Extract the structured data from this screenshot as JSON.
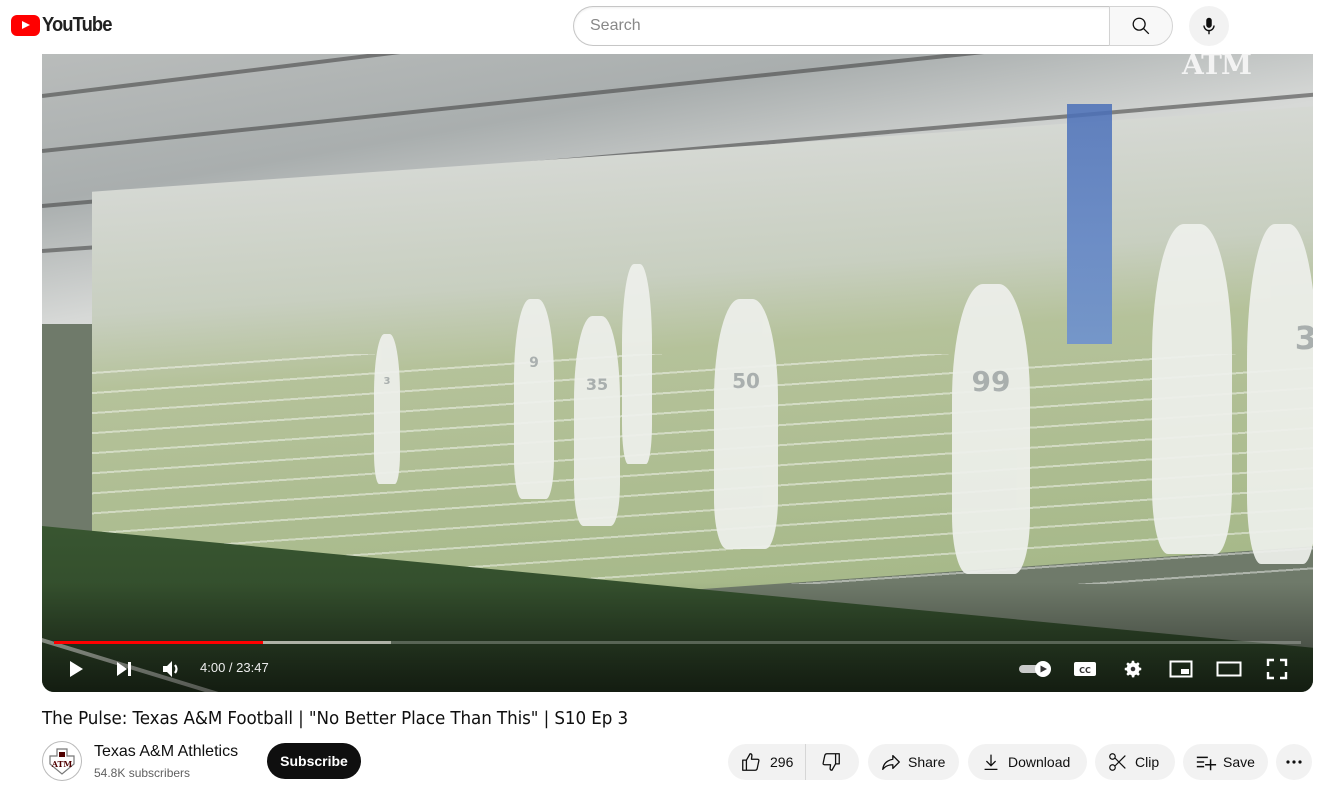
{
  "header": {
    "logo_text": "YouTube",
    "search_placeholder": "Search",
    "search_value": ""
  },
  "player": {
    "current_time": "4:00",
    "duration": "23:47",
    "time_display": "4:00 / 23:47",
    "progress_played_fraction": 0.168,
    "progress_buffered_fraction": 0.27,
    "watermark": "ATM",
    "autoplay_on": true,
    "jersey_numbers": [
      "3",
      "9",
      "35",
      "50",
      "99",
      "3"
    ],
    "controls": {
      "play": "play-icon",
      "next": "next-icon",
      "volume": "volume-icon",
      "autoplay": "autoplay-toggle",
      "captions": "captions-icon",
      "settings": "gear-icon",
      "miniplayer": "miniplayer-icon",
      "theater": "theater-icon",
      "fullscreen": "fullscreen-icon"
    }
  },
  "video": {
    "title": "The Pulse: Texas A&M Football | \"No Better Place Than This\" | S10 Ep 3"
  },
  "channel": {
    "name": "Texas A&M Athletics",
    "subscribers": "54.8K subscribers",
    "subscribe_label": "Subscribe",
    "avatar_text": "ATM"
  },
  "actions": {
    "like_count": "296",
    "share_label": "Share",
    "download_label": "Download",
    "clip_label": "Clip",
    "save_label": "Save",
    "more_label": "..."
  },
  "colors": {
    "brand_red": "#ff0000",
    "subscribe_bg": "#0f0f0f",
    "pill_bg": "#f2f2f2",
    "aggie_maroon": "#500000"
  }
}
